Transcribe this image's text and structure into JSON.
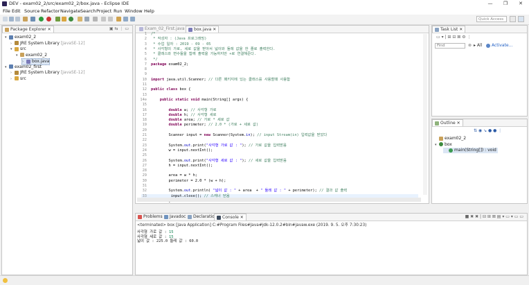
{
  "window": {
    "title": "DEV - exam02_2/src/exam02_2/box.java - Eclipse IDE",
    "controls": [
      "—",
      "❐",
      "✕"
    ]
  },
  "menu": [
    "File",
    "Edit",
    "Source",
    "Refactor",
    "Navigate",
    "Search",
    "Project",
    "Run",
    "Window",
    "Help"
  ],
  "toolbar": {
    "quick_access_placeholder": "Quick Access"
  },
  "package_explorer": {
    "tab_label": "Package Explorer",
    "tree": [
      {
        "indent": 0,
        "toggle": "▾",
        "icon": "project-icon",
        "label": "exam02_2",
        "extra": ""
      },
      {
        "indent": 1,
        "toggle": "›",
        "icon": "library-icon",
        "label": "JRE System Library",
        "extra": "[JavaSE-12]"
      },
      {
        "indent": 1,
        "toggle": "▾",
        "icon": "src-folder-icon",
        "label": "src",
        "extra": ""
      },
      {
        "indent": 2,
        "toggle": "▾",
        "icon": "package-icon",
        "label": "exam02_2",
        "extra": ""
      },
      {
        "indent": 3,
        "toggle": "›",
        "icon": "java-file-icon",
        "label": "box.java",
        "extra": ""
      },
      {
        "indent": 0,
        "toggle": "▾",
        "icon": "project-icon",
        "label": "exam02_first",
        "extra": ""
      },
      {
        "indent": 1,
        "toggle": "›",
        "icon": "library-icon",
        "label": "JRE System Library",
        "extra": "[JavaSE-12]"
      },
      {
        "indent": 1,
        "toggle": "›",
        "icon": "src-folder-icon",
        "label": "src",
        "extra": ""
      }
    ]
  },
  "editor": {
    "tabs": [
      {
        "label": "Exam_02_First.java",
        "active": false
      },
      {
        "label": "box.java",
        "active": true
      }
    ],
    "lines": [
      {
        "n": "1",
        "segs": [
          {
            "t": "/*",
            "c": "cm"
          }
        ]
      },
      {
        "n": "2",
        "segs": [
          {
            "t": " * 작성자 : (Java 프로그래밍)",
            "c": "cm"
          }
        ]
      },
      {
        "n": "3",
        "segs": [
          {
            "t": " * 수업 일자 : 2019 - 09 - 05",
            "c": "cm"
          }
        ]
      },
      {
        "n": "4",
        "segs": [
          {
            "t": " * 사각형의 가로, 세로 값을 받아서 넓이와 둘레 값을 한 줄로 출력한다.",
            "c": "cm"
          }
        ]
      },
      {
        "n": "5",
        "segs": [
          {
            "t": " * 클래스와 변수들을 함께 출력을 가능하지만 +로 연결해준다.",
            "c": "cm"
          }
        ]
      },
      {
        "n": "6",
        "segs": [
          {
            "t": " */",
            "c": "cm"
          }
        ]
      },
      {
        "n": "7",
        "segs": [
          {
            "t": "package",
            "c": "kw"
          },
          {
            "t": " exam02_2;",
            "c": ""
          }
        ]
      },
      {
        "n": "8",
        "segs": []
      },
      {
        "n": "9",
        "segs": []
      },
      {
        "n": "10",
        "segs": [
          {
            "t": "import",
            "c": "kw"
          },
          {
            "t": " java.util.Scanner; ",
            "c": ""
          },
          {
            "t": "// 다른 패키지에 있는 클래스를 사용할때 사용함",
            "c": "cm"
          }
        ]
      },
      {
        "n": "11",
        "segs": []
      },
      {
        "n": "12",
        "segs": [
          {
            "t": "public",
            "c": "kw"
          },
          {
            "t": " ",
            "c": ""
          },
          {
            "t": "class",
            "c": "kw"
          },
          {
            "t": " box {",
            "c": ""
          }
        ]
      },
      {
        "n": "13",
        "segs": []
      },
      {
        "n": "14⊖",
        "segs": [
          {
            "t": "    ",
            "c": ""
          },
          {
            "t": "public",
            "c": "kw"
          },
          {
            "t": " ",
            "c": ""
          },
          {
            "t": "static",
            "c": "kw"
          },
          {
            "t": " ",
            "c": ""
          },
          {
            "t": "void",
            "c": "kw"
          },
          {
            "t": " main(String[] args) {",
            "c": ""
          }
        ]
      },
      {
        "n": "15",
        "segs": []
      },
      {
        "n": "16",
        "segs": [
          {
            "t": "        ",
            "c": ""
          },
          {
            "t": "double",
            "c": "kw"
          },
          {
            "t": " w; ",
            "c": ""
          },
          {
            "t": "// 사각형 가로",
            "c": "cm"
          }
        ]
      },
      {
        "n": "17",
        "segs": [
          {
            "t": "        ",
            "c": ""
          },
          {
            "t": "double",
            "c": "kw"
          },
          {
            "t": " h; ",
            "c": ""
          },
          {
            "t": "// 사각형 세로",
            "c": "cm"
          }
        ]
      },
      {
        "n": "18",
        "segs": [
          {
            "t": "        ",
            "c": ""
          },
          {
            "t": "double",
            "c": "kw"
          },
          {
            "t": " area; ",
            "c": ""
          },
          {
            "t": "// 가로 * 세로 값",
            "c": "cm"
          }
        ]
      },
      {
        "n": "19",
        "segs": [
          {
            "t": "        ",
            "c": ""
          },
          {
            "t": "double",
            "c": "kw"
          },
          {
            "t": " perimeter; ",
            "c": ""
          },
          {
            "t": "// 2.0 * (가로 + 세로 값)",
            "c": "cm"
          }
        ]
      },
      {
        "n": "20",
        "segs": []
      },
      {
        "n": "21",
        "segs": [
          {
            "t": "        Scanner input = ",
            "c": ""
          },
          {
            "t": "new",
            "c": "kw"
          },
          {
            "t": " Scanner(System.",
            "c": ""
          },
          {
            "t": "in",
            "c": "fd"
          },
          {
            "t": "); ",
            "c": ""
          },
          {
            "t": "// input Stream(in) 입력값을 받았다",
            "c": "cm"
          }
        ]
      },
      {
        "n": "22",
        "segs": []
      },
      {
        "n": "23",
        "segs": [
          {
            "t": "        System.",
            "c": ""
          },
          {
            "t": "out",
            "c": "fd"
          },
          {
            "t": ".print(",
            "c": ""
          },
          {
            "t": "\"사각형 가로 값 : \"",
            "c": "st"
          },
          {
            "t": "); ",
            "c": ""
          },
          {
            "t": "// 가로 값을 입력받음",
            "c": "cm"
          }
        ]
      },
      {
        "n": "24",
        "segs": [
          {
            "t": "        w = input.nextInt();",
            "c": ""
          }
        ]
      },
      {
        "n": "25",
        "segs": []
      },
      {
        "n": "26",
        "segs": [
          {
            "t": "        System.",
            "c": ""
          },
          {
            "t": "out",
            "c": "fd"
          },
          {
            "t": ".print(",
            "c": ""
          },
          {
            "t": "\"사각형 세로 값 : \"",
            "c": "st"
          },
          {
            "t": "); ",
            "c": ""
          },
          {
            "t": "// 세로 값을 입력받음",
            "c": "cm"
          }
        ]
      },
      {
        "n": "27",
        "segs": [
          {
            "t": "        h = input.nextInt();",
            "c": ""
          }
        ]
      },
      {
        "n": "28",
        "segs": []
      },
      {
        "n": "29",
        "segs": [
          {
            "t": "        area = w * h;",
            "c": ""
          }
        ]
      },
      {
        "n": "30",
        "segs": [
          {
            "t": "        perimeter = 2.0 * (w + h);",
            "c": ""
          }
        ]
      },
      {
        "n": "31",
        "segs": []
      },
      {
        "n": "32",
        "segs": [
          {
            "t": "        System.",
            "c": ""
          },
          {
            "t": "out",
            "c": "fd"
          },
          {
            "t": ".println( ",
            "c": ""
          },
          {
            "t": "\"넓이 값 : \"",
            "c": "st"
          },
          {
            "t": " + area  + ",
            "c": ""
          },
          {
            "t": "\" 둘레 값 : \"",
            "c": "st"
          },
          {
            "t": " + perimeter); ",
            "c": ""
          },
          {
            "t": "// 결과 값 출력",
            "c": "cm"
          }
        ]
      },
      {
        "n": "33",
        "segs": [
          {
            "t": "         input.close(); ",
            "c": ""
          },
          {
            "t": "// 스캐너 닫음",
            "c": "cm"
          }
        ]
      },
      {
        "n": "34",
        "segs": [
          {
            "t": "        }",
            "c": ""
          }
        ]
      }
    ]
  },
  "task_list": {
    "tab_label": "Task List",
    "find_placeholder": "Find",
    "all_label": "All",
    "activate_label": "Activate..."
  },
  "outline": {
    "tab_label": "Outline",
    "items": [
      {
        "label": "exam02_2",
        "icon": "package-icon",
        "indent": 0,
        "toggle": ""
      },
      {
        "label": "box",
        "icon": "class-icon",
        "indent": 0,
        "toggle": "▾"
      },
      {
        "label": "main(String[]) : void",
        "icon": "method-icon",
        "indent": 1,
        "toggle": ""
      }
    ]
  },
  "bottom": {
    "tabs": [
      {
        "label": "Problems",
        "icon": "problems-icon",
        "active": false
      },
      {
        "label": "Javadoc",
        "icon": "javadoc-icon",
        "active": false
      },
      {
        "label": "Declaration",
        "icon": "declaration-icon",
        "active": false
      },
      {
        "label": "Console",
        "icon": "console-icon",
        "active": true
      }
    ],
    "terminated": "<terminated> box [Java Application] C:#Program Files#Java#jdk-12.0.2#bin#javaw.exe (2019. 9. 5. 오후 7:30:23)",
    "output": [
      {
        "text": "사각형 가로 값 : ",
        "input": "15"
      },
      {
        "text": "사각형 세로 값 : ",
        "input": "15"
      },
      {
        "text": "넓이 값 : 225.0 둘레 값 : 60.0",
        "input": ""
      }
    ]
  }
}
